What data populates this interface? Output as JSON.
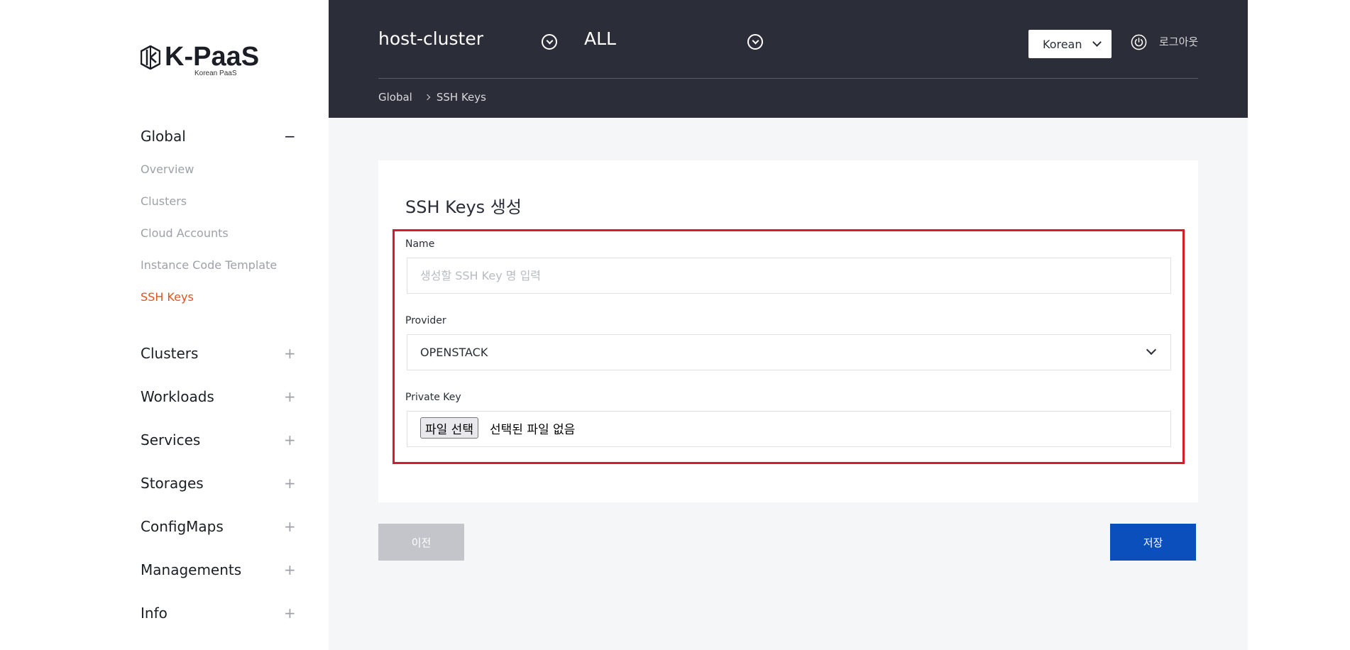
{
  "logo": {
    "name": "K-PaaS",
    "subtitle": "Korean PaaS"
  },
  "sidebar": {
    "global": {
      "label": "Global",
      "toggle": "−",
      "items": [
        {
          "label": "Overview"
        },
        {
          "label": "Clusters"
        },
        {
          "label": "Cloud Accounts"
        },
        {
          "label": "Instance Code Template"
        },
        {
          "label": "SSH Keys",
          "active": true
        }
      ]
    },
    "sections": [
      {
        "label": "Clusters",
        "toggle": "+"
      },
      {
        "label": "Workloads",
        "toggle": "+"
      },
      {
        "label": "Services",
        "toggle": "+"
      },
      {
        "label": "Storages",
        "toggle": "+"
      },
      {
        "label": "ConfigMaps",
        "toggle": "+"
      },
      {
        "label": "Managements",
        "toggle": "+"
      },
      {
        "label": "Info",
        "toggle": "+"
      }
    ]
  },
  "header": {
    "cluster": "host-cluster",
    "namespace": "ALL",
    "language": "Korean",
    "logout_label": "로그아웃",
    "breadcrumb": [
      "Global",
      "SSH Keys"
    ]
  },
  "form": {
    "title": "SSH Keys 생성",
    "name_label": "Name",
    "name_placeholder": "생성할 SSH Key 명 입력",
    "name_value": "",
    "provider_label": "Provider",
    "provider_value": "OPENSTACK",
    "private_key_label": "Private Key",
    "file_button_label": "파일 선택",
    "file_status": "선택된 파일 없음"
  },
  "actions": {
    "prev_label": "이전",
    "save_label": "저장"
  },
  "colors": {
    "header_bg": "#2b2e38",
    "active_nav": "#e0541c",
    "highlight_border": "#d51d2a",
    "save_button": "#0b4fbd",
    "prev_button": "#c3c5ca"
  }
}
